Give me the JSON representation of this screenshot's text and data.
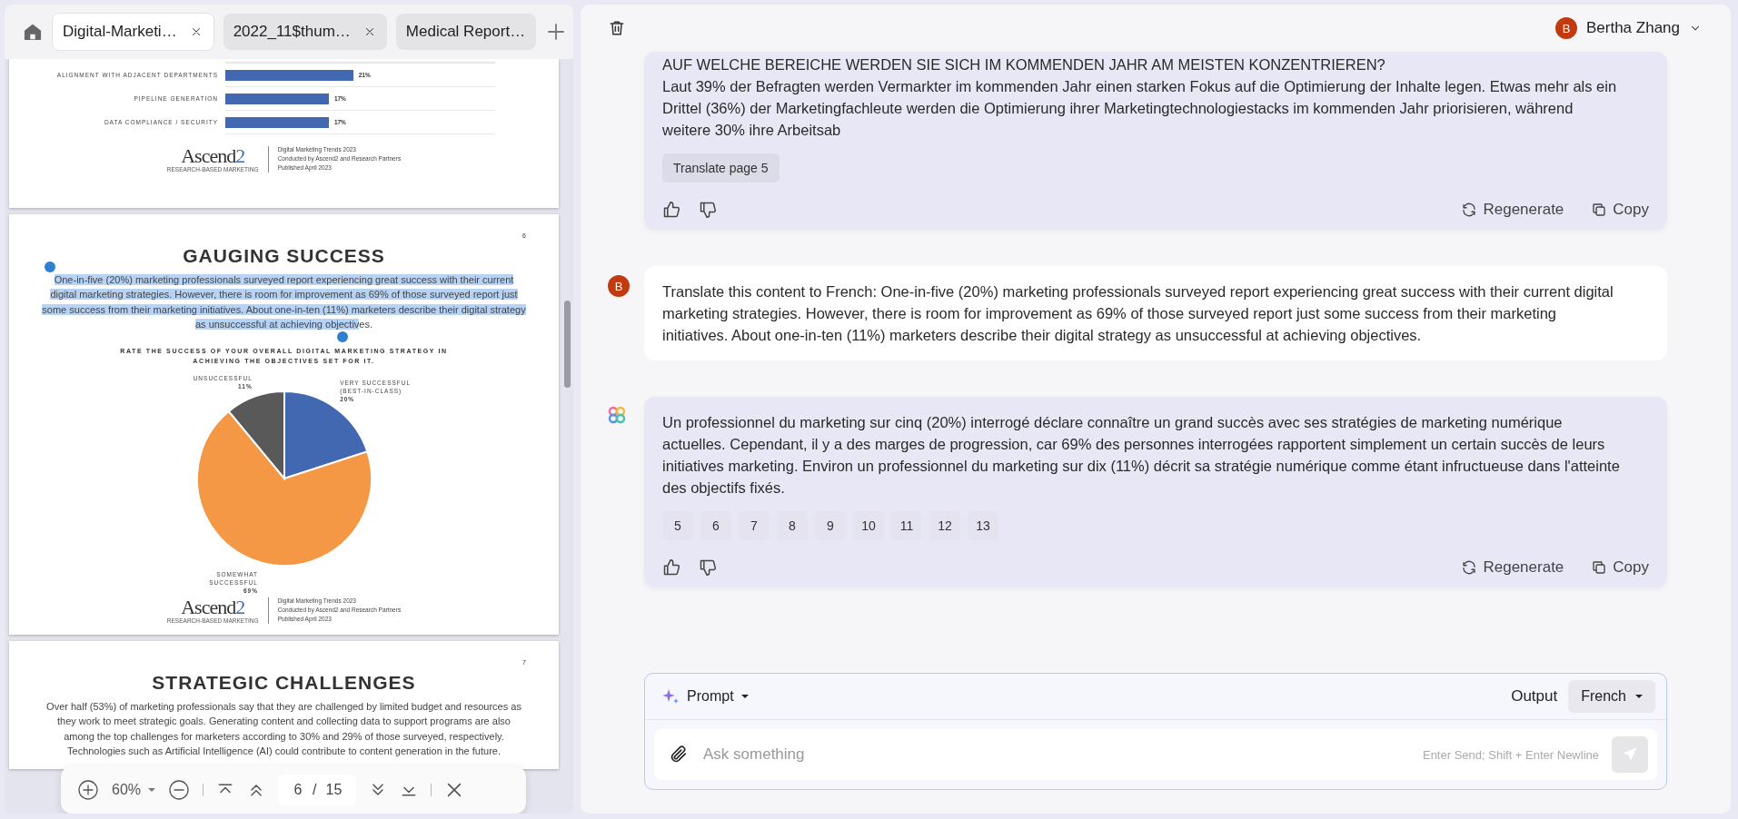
{
  "tabs": [
    {
      "label": "Digital-Marketi…",
      "selected": true,
      "closable": true
    },
    {
      "label": "2022_11$thum…",
      "selected": false,
      "closable": true
    },
    {
      "label": "Medical Report…",
      "selected": false,
      "closable": false
    }
  ],
  "pdf_pages": [
    {
      "kind": "chart_fragment",
      "chart_data": {
        "type": "bar",
        "orientation": "horizontal",
        "categories": [
          "ALIGNMENT WITH ADJACENT DEPARTMENTS",
          "PIPELINE GENERATION",
          "DATA COMPLIANCE / SECURITY"
        ],
        "series": [
          {
            "color": "#4268b1",
            "values": [
              21,
              17,
              17
            ],
            "value_labels": [
              "21%",
              "17%",
              "17%"
            ]
          }
        ]
      },
      "footer": {
        "logo": "Ascend2",
        "tagline": "RESEARCH-BASED MARKETING",
        "lines": [
          "Digital Marketing Trends 2023",
          "Conducted by Ascend2 and Research Partners",
          "Published April 2023"
        ]
      }
    },
    {
      "kind": "content",
      "page_number": "6",
      "heading": "GAUGING SUCCESS",
      "paragraph": {
        "selected_text": "One-in-five (20%) marketing professionals surveyed report experiencing great success with their current digital marketing strategies. However, there is room for improvement as 69% of those surveyed report just some success from their marketing initiatives. About one-in-ten (11%) marketers describe their digital strategy as unsuccessful at achieving objectiv",
        "text_after": "es."
      },
      "chart_data": {
        "type": "pie",
        "title": "RATE THE SUCCESS OF YOUR OVERALL DIGITAL MARKETING STRATEGY IN ACHIEVING THE OBJECTIVES SET FOR IT.",
        "categories": [
          "VERY SUCCESSFUL (BEST-IN-CLASS)",
          "SOMEWHAT SUCCESSFUL",
          "UNSUCCESSFUL"
        ],
        "series": [
          {
            "values": [
              20,
              69,
              11
            ],
            "value_labels": [
              "20%",
              "69%",
              "11%"
            ]
          }
        ],
        "colors": [
          "#4268b1",
          "#f59845",
          "#595959"
        ]
      },
      "footer": {
        "logo": "Ascend2",
        "tagline": "RESEARCH-BASED MARKETING",
        "lines": [
          "Digital Marketing Trends 2023",
          "Conducted by Ascend2 and Research Partners",
          "Published April 2023"
        ]
      }
    },
    {
      "kind": "content",
      "page_number": "7",
      "heading": "STRATEGIC CHALLENGES",
      "paragraph": {
        "text": "Over half (53%) of marketing professionals say that they are challenged by limited budget and resources as they work to meet strategic goals. Generating content and collecting data to support programs are also among the top challenges for marketers according to 30% and 29% of those surveyed, respectively. Technologies such as Artificial Intelligence (AI) could contribute to content generation in the future."
      }
    }
  ],
  "pdf_toolbar": {
    "zoom": "60%",
    "page": "6",
    "page_separator": "/",
    "page_count": "15"
  },
  "user": {
    "initial": "B",
    "name": "Bertha Zhang"
  },
  "messages": [
    {
      "kind": "assistant",
      "avatar_visible": false,
      "heading": "AUF WELCHE BEREICHE WERDEN SIE SICH IM KOMMENDEN JAHR AM MEISTEN KONZENTRIEREN?",
      "text": "Laut 39% der Befragten werden Vermarkter im kommenden Jahr einen starken Fokus auf die Optimierung der Inhalte legen. Etwas mehr als ein Drittel (36%) der Marketingfachleute werden die Optimierung ihrer Marketingtechnologiestacks im kommenden Jahr priorisieren, während weitere 30% ihre Arbeitsab",
      "chips": [
        "Translate page 5"
      ],
      "actions": [
        "Regenerate",
        "Copy"
      ]
    },
    {
      "kind": "user",
      "avatar_visible": true,
      "avatar_initial": "B",
      "text": "Translate this content to French: One-in-five (20%) marketing professionals surveyed report experiencing great success with their current digital marketing strategies. However, there is room for improvement as 69% of those surveyed report just some success from their marketing initiatives. About one-in-ten (11%) marketers describe their digital strategy as unsuccessful at achieving objectives."
    },
    {
      "kind": "assistant",
      "avatar_visible": true,
      "text": "Un professionnel du marketing sur cinq (20%) interrogé déclare connaître un grand succès avec ses stratégies de marketing numérique actuelles. Cependant, il y a des marges de progression, car 69% des personnes interrogées rapportent simplement un certain succès de leurs initiatives marketing. Environ un professionnel du marketing sur dix (11%) décrit sa stratégie numérique comme étant infructueuse dans l'atteinte des objectifs fixés.",
      "chips": [
        "5",
        "6",
        "7",
        "8",
        "9",
        "10",
        "11",
        "12",
        "13"
      ],
      "actions": [
        "Regenerate",
        "Copy"
      ]
    }
  ],
  "composer": {
    "mode": "Prompt",
    "output_label": "Output",
    "output_language": "French",
    "placeholder": "Ask something",
    "hint": "Enter Send; Shift + Enter Newline"
  }
}
